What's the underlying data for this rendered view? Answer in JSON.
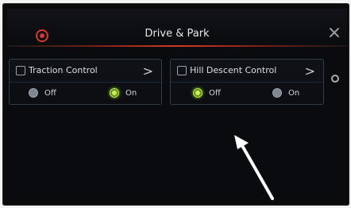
{
  "window": {
    "title": "Drive & Park"
  },
  "cards": [
    {
      "title": "Traction Control",
      "chevron": ">",
      "options": [
        {
          "label": "Off",
          "selected": false
        },
        {
          "label": "On",
          "selected": true
        }
      ]
    },
    {
      "title": "Hill Descent Control",
      "chevron": ">",
      "options": [
        {
          "label": "Off",
          "selected": true
        },
        {
          "label": "On",
          "selected": false
        }
      ]
    }
  ],
  "colors": {
    "accent_red": "#d63a25",
    "selected_green": "#b8e04a"
  },
  "icons": {
    "settings": "gear-icon",
    "close": "close-icon",
    "traction": "traction-control-icon",
    "hill": "hill-descent-icon"
  }
}
